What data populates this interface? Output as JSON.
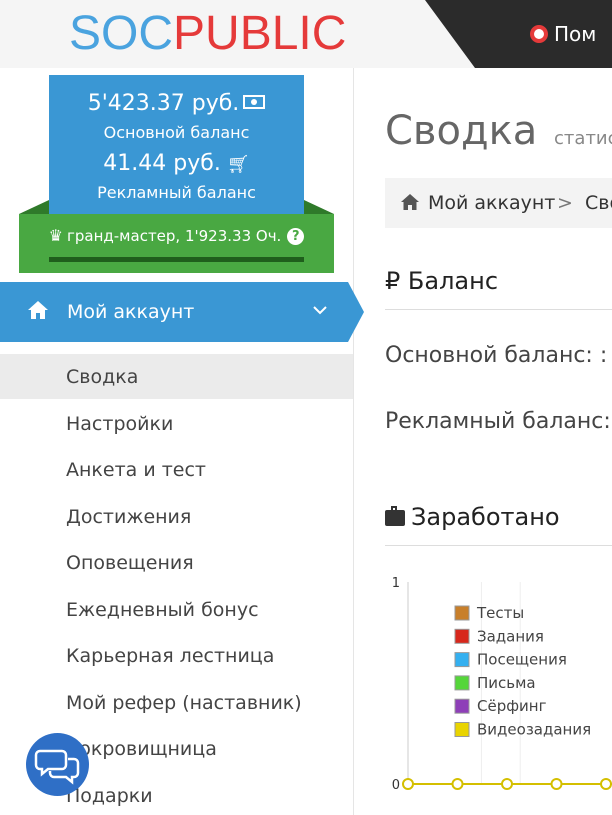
{
  "header": {
    "logo_part1": "SOC",
    "logo_part2": "PUBLIC",
    "help_label": "Пом",
    "logo_colors": {
      "soc": "#4aa3df",
      "public": "#e53a3a"
    }
  },
  "balances": {
    "main_value": "5'423.37 руб.",
    "main_label": "Основной баланс",
    "ad_value": "41.44 руб.",
    "ad_label": "Рекламный баланс",
    "main_icon": "money-icon",
    "ad_icon": "cart-icon"
  },
  "rank": {
    "text": "гранд-мастер, 1'923.33 Оч.",
    "icon": "crown-icon",
    "help_icon": "?"
  },
  "nav": {
    "active_label": "Мой аккаунт",
    "active_icon": "home-icon",
    "sub_items": [
      "Сводка",
      "Настройки",
      "Анкета и тест",
      "Достижения",
      "Оповещения",
      "Ежедневный бонус",
      "Карьерная лестница",
      "Мой рефер (наставник)",
      "Сокровищница",
      "Подарки"
    ],
    "selected_index": 0
  },
  "content": {
    "title": "Сводка",
    "subtitle": "статисти",
    "breadcrumb": [
      "Мой аккаунт",
      "Сво"
    ],
    "breadcrumb_sep": ">",
    "balance_section_icon": "₽",
    "balance_section_title": "Баланс",
    "main_balance_line": "Основной баланс: :",
    "ad_balance_line": "Рекламный баланс:",
    "earned_section_title": "Заработано",
    "earned_section_icon": "briefcase-icon"
  },
  "chart_data": {
    "type": "line",
    "y_ticks": [
      "1",
      "0"
    ],
    "ylim": [
      0,
      1
    ],
    "legend_position": "top-left",
    "series": [
      {
        "name": "Тесты",
        "color": "#c87f2a",
        "values": [
          0,
          0,
          0,
          0,
          0
        ]
      },
      {
        "name": "Задания",
        "color": "#d7271c",
        "values": [
          0,
          0,
          0,
          0,
          0
        ]
      },
      {
        "name": "Посещения",
        "color": "#34b0f0",
        "values": [
          0,
          0,
          0,
          0,
          0
        ]
      },
      {
        "name": "Письма",
        "color": "#55d63a",
        "values": [
          0,
          0,
          0,
          0,
          0
        ]
      },
      {
        "name": "Сёрфинг",
        "color": "#8e3fb8",
        "values": [
          0,
          0,
          0,
          0,
          0
        ]
      },
      {
        "name": "Видеозадания",
        "color": "#e9d400",
        "values": [
          0,
          0,
          0,
          0,
          0
        ]
      }
    ]
  }
}
